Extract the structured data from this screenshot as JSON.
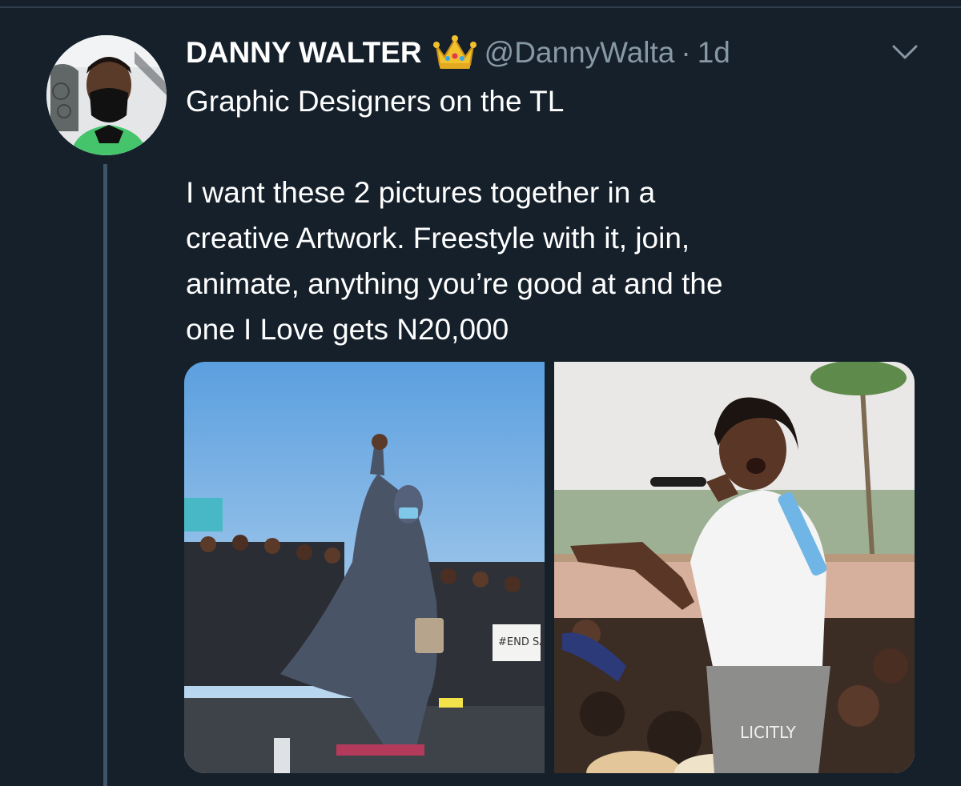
{
  "tweet": {
    "author_name": "DANNY WALTER",
    "badge_icon": "crown-icon",
    "handle": "@DannyWalta",
    "separator": "·",
    "time": "1d",
    "menu_icon": "chevron-down-icon",
    "text_lines": [
      "Graphic Designers on the TL",
      "I want these 2 pictures together in a",
      "creative Artwork. Freestyle with it, join,",
      "animate, anything you’re good at and the",
      "one I Love gets N20,000"
    ],
    "media": [
      {
        "kind": "photo",
        "placard_text": "#END SARS"
      },
      {
        "kind": "photo",
        "shirt_text": "LICITLY"
      }
    ]
  },
  "colors": {
    "background": "#15202b",
    "primary_text": "#ffffff",
    "secondary_text": "#8899a6",
    "thread_line": "#3d5466"
  }
}
